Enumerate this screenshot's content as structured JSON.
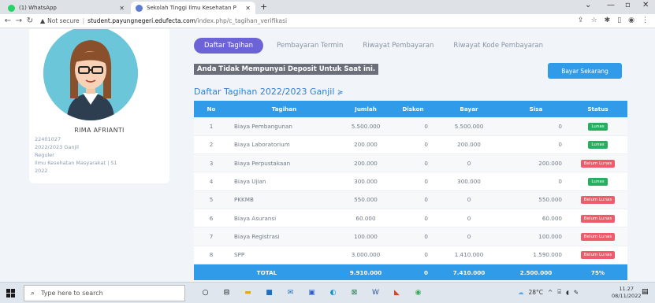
{
  "browser": {
    "tabs": [
      {
        "title": "(1) WhatsApp",
        "favicon_color": "#25d366",
        "active": false
      },
      {
        "title": "Sekolah Tinggi Ilmu Kesehatan P",
        "favicon_color": "#5b7bd5",
        "active": true
      }
    ],
    "new_tab": "+",
    "url": {
      "security": "Not secure",
      "host": "student.payungnegeri.edufecta.com",
      "path": "/index.php/c_tagihan_verifikasi"
    }
  },
  "profile": {
    "name": "RIMA AFRIANTI",
    "nim": "22401027",
    "period": "2022/2023 Ganjil",
    "class": "Reguler",
    "program": "Ilmu Kesehatan Masyarakat | S1",
    "year": "2022"
  },
  "page_tabs": [
    "Daftar Tagihan",
    "Pembayaran Termin",
    "Riwayat Pembayaran",
    "Riwayat Kode Pembayaran"
  ],
  "deposit_notice": "Anda Tidak Mempunyai Deposit Untuk Saat ini.",
  "pay_button": "Bayar Sekarang",
  "section_title": "Daftar Tagihan 2022/2023 Ganjil",
  "table": {
    "headers": [
      "No",
      "Tagihan",
      "Jumlah",
      "Diskon",
      "Bayar",
      "Sisa",
      "Status"
    ],
    "rows": [
      {
        "no": "1",
        "tagihan": "Biaya Pembangunan",
        "jumlah": "5.500.000",
        "diskon": "0",
        "bayar": "5.500.000",
        "sisa": "0",
        "status": "Lunas"
      },
      {
        "no": "2",
        "tagihan": "Biaya Laboratorium",
        "jumlah": "200.000",
        "diskon": "0",
        "bayar": "200.000",
        "sisa": "0",
        "status": "Lunas"
      },
      {
        "no": "3",
        "tagihan": "Biaya Perpustakaan",
        "jumlah": "200.000",
        "diskon": "0",
        "bayar": "0",
        "sisa": "200.000",
        "status": "Belum Lunas"
      },
      {
        "no": "4",
        "tagihan": "Biaya Ujian",
        "jumlah": "300.000",
        "diskon": "0",
        "bayar": "300.000",
        "sisa": "0",
        "status": "Lunas"
      },
      {
        "no": "5",
        "tagihan": "PKKMB",
        "jumlah": "550.000",
        "diskon": "0",
        "bayar": "0",
        "sisa": "550.000",
        "status": "Belum Lunas"
      },
      {
        "no": "6",
        "tagihan": "Biaya Asuransi",
        "jumlah": "60.000",
        "diskon": "0",
        "bayar": "0",
        "sisa": "60.000",
        "status": "Belum Lunas"
      },
      {
        "no": "7",
        "tagihan": "Biaya Registrasi",
        "jumlah": "100.000",
        "diskon": "0",
        "bayar": "0",
        "sisa": "100.000",
        "status": "Belum Lunas"
      },
      {
        "no": "8",
        "tagihan": "SPP",
        "jumlah": "3.000.000",
        "diskon": "0",
        "bayar": "1.410.000",
        "sisa": "1.590.000",
        "status": "Belum Lunas"
      }
    ],
    "total": {
      "label": "TOTAL",
      "jumlah": "9.910.000",
      "diskon": "0",
      "bayar": "7.410.000",
      "sisa": "2.500.000",
      "status": "75%"
    }
  },
  "colors": {
    "accent": "#2f9be9",
    "tab_active": "#6c63d6",
    "lunas": "#27ae60",
    "belum_lunas": "#ef5b6b"
  },
  "taskbar": {
    "search_placeholder": "Type here to search",
    "weather": "28°C",
    "time": "11.27",
    "date": "08/11/2022"
  }
}
